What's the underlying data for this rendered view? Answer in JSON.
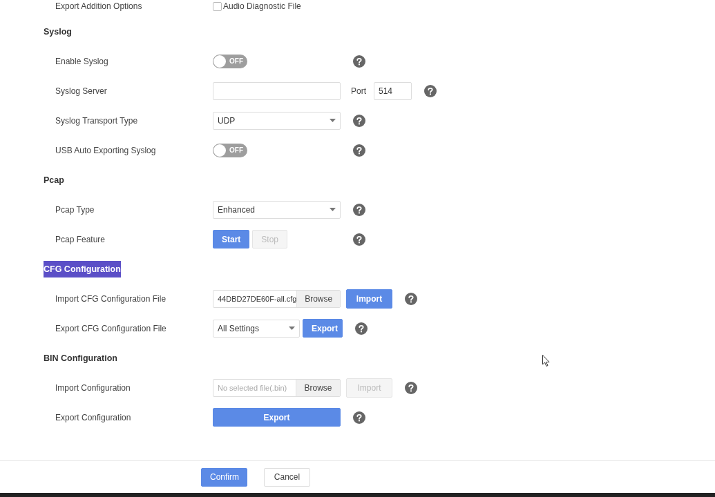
{
  "sections": [
    {
      "rows": [
        {
          "kind": "checkbox",
          "label": "Export Addition Options",
          "option": "Audio Diagnostic File",
          "checked": false,
          "help": false
        }
      ]
    },
    {
      "title": "Syslog",
      "highlighted": false,
      "rows": [
        {
          "kind": "toggle",
          "label": "Enable Syslog",
          "on": false,
          "state_text": "OFF",
          "help": true
        },
        {
          "kind": "server",
          "label": "Syslog Server",
          "port_label": "Port",
          "port_value": "514",
          "help": true
        },
        {
          "kind": "select",
          "label": "Syslog Transport Type",
          "value": "UDP",
          "help": true
        },
        {
          "kind": "toggle",
          "label": "USB Auto Exporting Syslog",
          "on": false,
          "state_text": "OFF",
          "help": true
        }
      ]
    },
    {
      "title": "Pcap",
      "highlighted": false,
      "rows": [
        {
          "kind": "select",
          "label": "Pcap Type",
          "value": "Enhanced",
          "help": true
        },
        {
          "kind": "buttons",
          "label": "Pcap Feature",
          "buttons": [
            {
              "label": "Start",
              "disabled": false
            },
            {
              "label": "Stop",
              "disabled": true
            }
          ],
          "help": true
        }
      ]
    },
    {
      "title": "CFG Configuration",
      "highlighted": true,
      "rows": [
        {
          "kind": "file",
          "label": "Import CFG Configuration File",
          "value": "44DBD27DE60F-all.cfg",
          "browse": "Browse",
          "action": {
            "label": "Import",
            "disabled": false
          },
          "help": true
        },
        {
          "kind": "select_button",
          "label": "Export CFG Configuration File",
          "value": "All Settings",
          "action": {
            "label": "Export",
            "disabled": false
          },
          "help": true
        }
      ]
    },
    {
      "title": "BIN Configuration",
      "highlighted": false,
      "rows": [
        {
          "kind": "file",
          "label": "Import Configuration",
          "placeholder": "No selected file(.bin)",
          "browse": "Browse",
          "action": {
            "label": "Import",
            "disabled": true
          },
          "help": true
        },
        {
          "kind": "wide_button",
          "label": "Export Configuration",
          "action": {
            "label": "Export",
            "disabled": false
          },
          "help": true
        }
      ]
    }
  ],
  "footer": {
    "buttons": [
      {
        "label": "Confirm",
        "kind": "primary"
      },
      {
        "label": "Cancel",
        "kind": "default"
      }
    ]
  }
}
